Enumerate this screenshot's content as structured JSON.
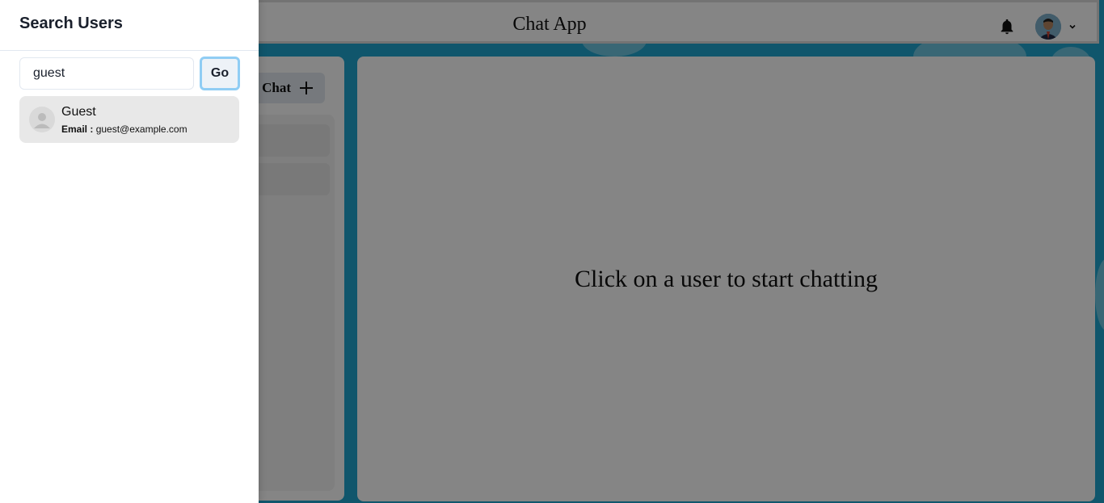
{
  "header": {
    "title": "Chat App",
    "notification_icon": "bell-icon",
    "profile_icon": "avatar",
    "menu_icon": "chevron-down-icon"
  },
  "chats_panel": {
    "new_chat_label": "Chat",
    "new_chat_icon": "plus-icon"
  },
  "chat_box": {
    "placeholder": "Click on a user to start chatting"
  },
  "drawer": {
    "title": "Search Users",
    "search_value": "guest",
    "go_label": "Go",
    "results": [
      {
        "name": "Guest",
        "email_label": "Email :",
        "email": "guest@example.com"
      }
    ]
  },
  "colors": {
    "background": "#1fa6cf",
    "focus_ring": "#90cdf4",
    "button_bg": "#edf2f7"
  }
}
